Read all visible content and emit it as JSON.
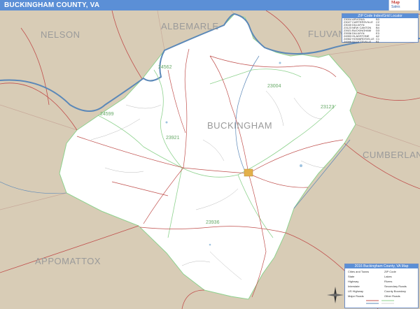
{
  "title": "BUCKINGHAM COUNTY, VA",
  "brand": {
    "line1": "Map",
    "line2": "Sales"
  },
  "neighbors": [
    {
      "id": "nelson",
      "label": "NELSON"
    },
    {
      "id": "albemarle",
      "label": "ALBEMARLE"
    },
    {
      "id": "fluvanna",
      "label": "FLUVANNA"
    },
    {
      "id": "cumberland",
      "label": "CUMBERLAND"
    },
    {
      "id": "appomattox",
      "label": "APPOMATTOX"
    },
    {
      "id": "buckingham",
      "label": "BUCKINGHAM"
    }
  ],
  "zip_labels": [
    "24562",
    "23004",
    "23123",
    "23921",
    "24599",
    "23936"
  ],
  "zip_table": {
    "title": "ZIP Code Index/Grid Locator",
    "rows": [
      [
        "23004",
        "ARVONIA",
        "B3"
      ],
      [
        "23027",
        "CARTERSVILLE",
        "C2"
      ],
      [
        "23040",
        "DILLWYN",
        "D4"
      ],
      [
        "23123",
        "NEW CANTON",
        "B4"
      ],
      [
        "23921",
        "BUCKINGHAM",
        "D3"
      ],
      [
        "23936",
        "DILLWYN",
        "E3"
      ],
      [
        "24553",
        "GLADSTONE",
        "A2"
      ],
      [
        "24562",
        "HOWARDSVILLE",
        "C1"
      ],
      [
        "24599",
        "SCOTTSVILLE",
        "B1"
      ]
    ]
  },
  "legend": {
    "title": "2016 Buckingham County, VA Map",
    "items": [
      "Cities and Towns",
      "State",
      "Highway",
      "Interstate",
      "US Highway",
      "Major Roads",
      "ZIP Code",
      "Lakes",
      "Rivers",
      "Secondary Roads",
      "County Boundary",
      "Other Roads"
    ]
  },
  "colors": {
    "outside": "#d8ccb6",
    "county": "#ffffff",
    "water": "#5b88b8",
    "road": "#c0504d",
    "zip_line": "#8ed28e",
    "minor_road": "#9a9a9a",
    "title_bar": "#5b8fd6",
    "town": "#e3b04b"
  }
}
